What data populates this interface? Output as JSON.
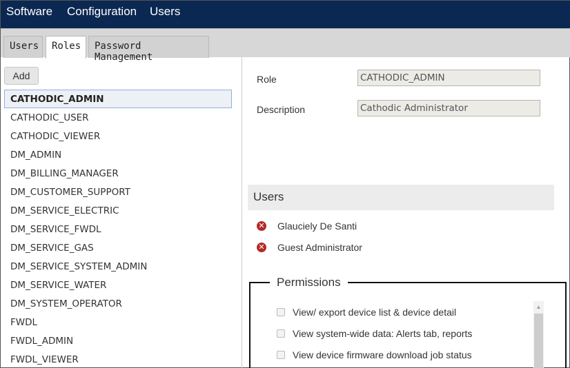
{
  "nav": {
    "items": [
      {
        "label": "Software"
      },
      {
        "label": "Configuration"
      },
      {
        "label": "Users"
      }
    ]
  },
  "tabs": [
    {
      "label": "Users",
      "active": false
    },
    {
      "label": "Roles",
      "active": true
    },
    {
      "label": "Password Management",
      "active": false
    }
  ],
  "roles": {
    "add_label": "Add",
    "items": [
      "CATHODIC_ADMIN",
      "CATHODIC_USER",
      "CATHODIC_VIEWER",
      "DM_ADMIN",
      "DM_BILLING_MANAGER",
      "DM_CUSTOMER_SUPPORT",
      "DM_SERVICE_ELECTRIC",
      "DM_SERVICE_FWDL",
      "DM_SERVICE_GAS",
      "DM_SERVICE_SYSTEM_ADMIN",
      "DM_SERVICE_WATER",
      "DM_SYSTEM_OPERATOR",
      "FWDL",
      "FWDL_ADMIN",
      "FWDL_VIEWER"
    ],
    "selected": "CATHODIC_ADMIN"
  },
  "detail": {
    "role_label": "Role",
    "role_value": "CATHODIC_ADMIN",
    "description_label": "Description",
    "description_value": "Cathodic Administrator"
  },
  "users_section": {
    "title": "Users",
    "users": [
      "Glauciely De Santi",
      "Guest Administrator"
    ],
    "remove_icon": "remove-circle-icon"
  },
  "permissions": {
    "title": "Permissions",
    "items": [
      {
        "label": "View/ export device list & device detail",
        "checked": false
      },
      {
        "label": "View system-wide data: Alerts tab, reports",
        "checked": false
      },
      {
        "label": "View device firmware download job status",
        "checked": false
      }
    ]
  },
  "colors": {
    "topbar": "#0b2852",
    "remove_icon": "#b52a2a",
    "selected_border": "#8fb0dc"
  }
}
